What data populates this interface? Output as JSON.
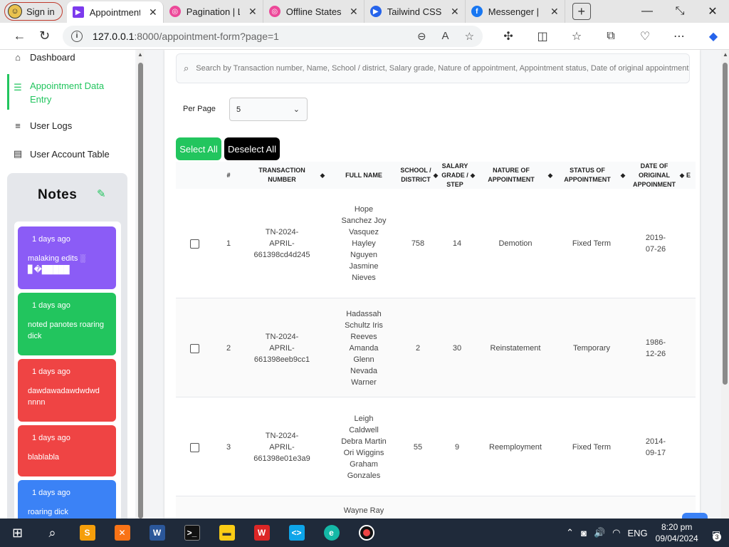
{
  "browser": {
    "profile_label": "Sign in",
    "tabs": [
      {
        "title": "Appointment I",
        "icon": "edge-tab-icon",
        "color": "#7c3aed"
      },
      {
        "title": "Pagination | La",
        "icon": "laravel-icon",
        "color": "#ec4899"
      },
      {
        "title": "Offline States |",
        "icon": "laravel-icon",
        "color": "#ec4899"
      },
      {
        "title": "Tailwind CSS S",
        "icon": "youtube-play-icon",
        "color": "#2563eb"
      },
      {
        "title": "Messenger | Fa",
        "icon": "facebook-icon",
        "color": "#1877f2"
      }
    ],
    "url_host": "127.0.0.1",
    "url_path": ":8000/appointment-form?page=1"
  },
  "sidebar": {
    "items": [
      {
        "label": "Dashboard",
        "icon": "home-icon"
      },
      {
        "label": "Appointment Data Entry",
        "icon": "numbered-list-icon",
        "active": true
      },
      {
        "label": "User Logs",
        "icon": "list-icon"
      },
      {
        "label": "User Account Table",
        "icon": "table-icon"
      }
    ]
  },
  "notes": {
    "title": "Notes",
    "items": [
      {
        "ago": "1 days ago",
        "text": "malaking edits ░ ▊�█████",
        "color": "#8b5cf6"
      },
      {
        "ago": "1 days ago",
        "text": "noted panotes roaring dick",
        "color": "#22c55e"
      },
      {
        "ago": "1 days ago",
        "text": "dawdawadawdwdwd nnnn",
        "color": "#ef4444"
      },
      {
        "ago": "1 days ago",
        "text": "blablabla",
        "color": "#ef4444"
      },
      {
        "ago": "1 days ago",
        "text": "roaring dick",
        "color": "#3b82f6"
      }
    ]
  },
  "main": {
    "search_placeholder": "Search by Transaction number, Name, School / district, Salary grade, Nature of appointment, Appointment status, Date of original appointment",
    "per_page_label": "Per Page",
    "per_page_value": "5",
    "select_all_label": "Select All",
    "deselect_all_label": "Deselect All",
    "columns": [
      "#",
      "TRANSACTION NUMBER",
      "FULL NAME",
      "SCHOOL / DISTRICT",
      "SALARY GRADE / STEP",
      "NATURE OF APPOINTMENT",
      "STATUS OF APPOINTMENT",
      "DATE OF ORIGINAL APPOINMENT",
      "E"
    ],
    "rows": [
      {
        "num": "1",
        "txn": "TN-2024-APRIL-661398cd4d245",
        "name": "Hope Sanchez Joy Vasquez Hayley Nguyen Jasmine Nieves",
        "school": "758",
        "grade": "14",
        "nature": "Demotion",
        "status": "Fixed Term",
        "date": "2019-07-26"
      },
      {
        "num": "2",
        "txn": "TN-2024-APRIL-661398eeb9cc1",
        "name": "Hadassah Schultz Iris Reeves Amanda Glenn Nevada Warner",
        "school": "2",
        "grade": "30",
        "nature": "Reinstatement",
        "status": "Temporary",
        "date": "1986-12-26"
      },
      {
        "num": "3",
        "txn": "TN-2024-APRIL-661398e01e3a9",
        "name": "Leigh Caldwell Debra Martin Ori Wiggins Graham Gonzales",
        "school": "55",
        "grade": "9",
        "nature": "Reemployment",
        "status": "Fixed Term",
        "date": "2014-09-17"
      },
      {
        "num": "",
        "txn": "",
        "name": "Wayne Ray",
        "school": "",
        "grade": "",
        "nature": "",
        "status": "",
        "date": ""
      }
    ]
  },
  "taskbar": {
    "lang": "ENG",
    "time": "8:20 pm",
    "date": "09/04/2024",
    "notif_count": "3"
  }
}
